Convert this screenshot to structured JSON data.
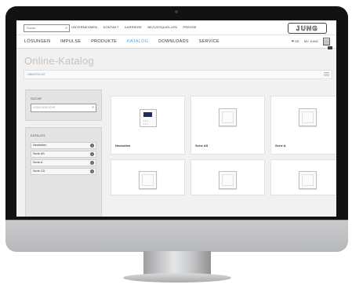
{
  "header": {
    "search_placeholder": "Suche",
    "util_links": [
      "UNTERNEHMEN",
      "KONTAKT",
      "KARRIERE",
      "BEZUGSQUELLEN",
      "PRESSE"
    ],
    "logo_text": "JUNG"
  },
  "nav": {
    "items": [
      "LÖSUNGEN",
      "IMPULSE",
      "PRODUKTE",
      "KATALOG",
      "DOWNLOADS",
      "SERVICE"
    ],
    "active": "KATALOG",
    "lang": "DE",
    "account": "MY JUNG"
  },
  "page": {
    "title": "Online-Katalog",
    "breadcrumb": "ÜBERSICHT"
  },
  "sidebar": {
    "search_label": "SUCHE",
    "search_placeholder": "KATALOGSUCHE",
    "catalog_label": "KATALOG",
    "items": [
      "Neuheiten",
      "Serie AS",
      "Serie A",
      "Serie CD"
    ]
  },
  "products": [
    {
      "label": "Neuheiten"
    },
    {
      "label": "Serie AS"
    },
    {
      "label": "Serie A"
    }
  ],
  "colors": {
    "active_nav": "#5aa0d8",
    "bezel": "#121212",
    "chin": "#c9cacc"
  }
}
